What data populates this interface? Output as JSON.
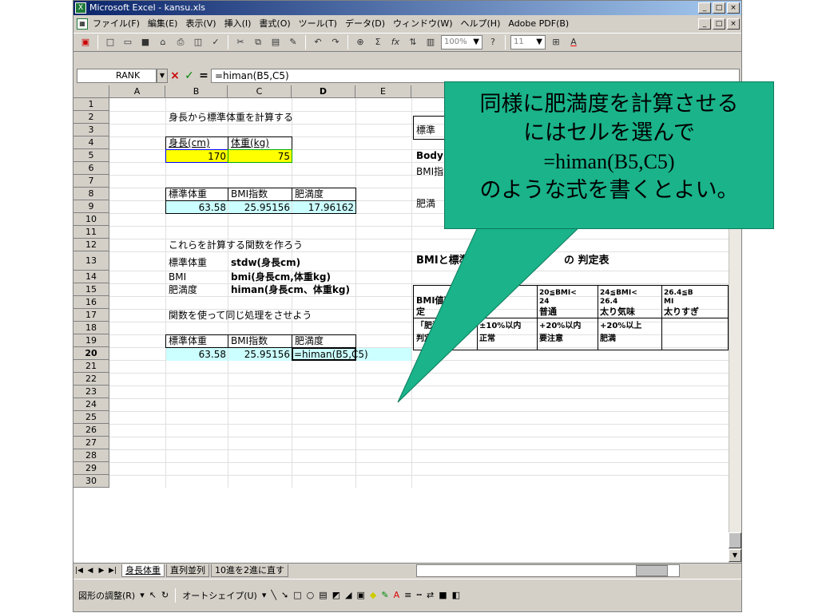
{
  "window": {
    "title": "Microsoft Excel - kansu.xls",
    "min_label": "_",
    "max_label": "□",
    "close_label": "×"
  },
  "menu": {
    "items": [
      "ファイル(F)",
      "編集(E)",
      "表示(V)",
      "挿入(I)",
      "書式(O)",
      "ツール(T)",
      "データ(D)",
      "ウィンドウ(W)",
      "ヘルプ(H)",
      "Adobe PDF(B)"
    ]
  },
  "toolbar": {
    "zoom": "100%",
    "font_size": "11"
  },
  "formula_bar": {
    "name_box": "RANK",
    "cancel": "×",
    "enter": "✓",
    "equals": "=",
    "formula": "=himan(B5,C5)"
  },
  "columns": [
    "A",
    "B",
    "C",
    "D",
    "E"
  ],
  "rows": [
    "1",
    "2",
    "3",
    "4",
    "5",
    "6",
    "7",
    "8",
    "9",
    "10",
    "11",
    "12",
    "13",
    "14",
    "15",
    "16",
    "17",
    "18",
    "19",
    "20",
    "21",
    "22",
    "23",
    "24",
    "25",
    "26",
    "27",
    "28",
    "29",
    "30"
  ],
  "sheet": {
    "b2": "身長から標準体重を計算する",
    "b4": "身長(cm)",
    "c4": "体重(kg)",
    "b5": "170",
    "c5": "75",
    "b8": "標準体重",
    "c8": "BMI指数",
    "d8": "肥満度",
    "b9": "63.58",
    "c9": "25.95156",
    "d9": "17.96162",
    "b12": "これらを計算する関数を作ろう",
    "b13": "標準体重",
    "c13": "stdw(身長cm)",
    "b14": "BMI",
    "c14": "bmi(身長cm,体重kg)",
    "b15": "肥満度",
    "c15": "himan(身長cm、体重kg)",
    "b17": "関数を使って同じ処理をさせよう",
    "b19": "標準体重",
    "c19": "BMI指数",
    "d19": "肥満度",
    "b20": "63.58",
    "c20": "25.95156",
    "d20": "=himan(B5,C5)"
  },
  "right_panel": {
    "f2": "標準",
    "f4": "Body",
    "f5": "BMI指",
    "f7": "肥満",
    "table_title": "BMIと標準体",
    "table_title_end": "の 判定表",
    "bmi_label": "BMI値判",
    "bmi_label2": "定",
    "h13": "20≦BMI<",
    "h13b": "24",
    "i13": "24≦BMI<",
    "i13b": "26.4",
    "j13": "26.4≦B",
    "j13b": "MI",
    "h14": "普通",
    "i14": "太り気味",
    "j14": "太りすぎ",
    "f15": "「肥満",
    "f16": "判定",
    "g15": "±10%以内",
    "g16": "正常",
    "h15": "+20%以内",
    "h16": "要注意",
    "i15": "+20%以上",
    "i16": "肥満"
  },
  "callout": {
    "line1": "同様に肥満度を計算させる",
    "line2": "にはセルを選んで",
    "line3": "=himan(B5,C5)",
    "line4": "のような式を書くとよい。"
  },
  "sheet_tabs": [
    "身長体重",
    "直列並列",
    "10進を2進に直す"
  ],
  "drawing_toolbar": {
    "draw_label": "図形の調整(R)",
    "autoshape_label": "オートシェイプ(U)"
  },
  "colors": {
    "callout": "#1ab38a",
    "input_cells": "#ffff00",
    "output_cells": "#ccffff",
    "title_bar": "#0a246a"
  }
}
